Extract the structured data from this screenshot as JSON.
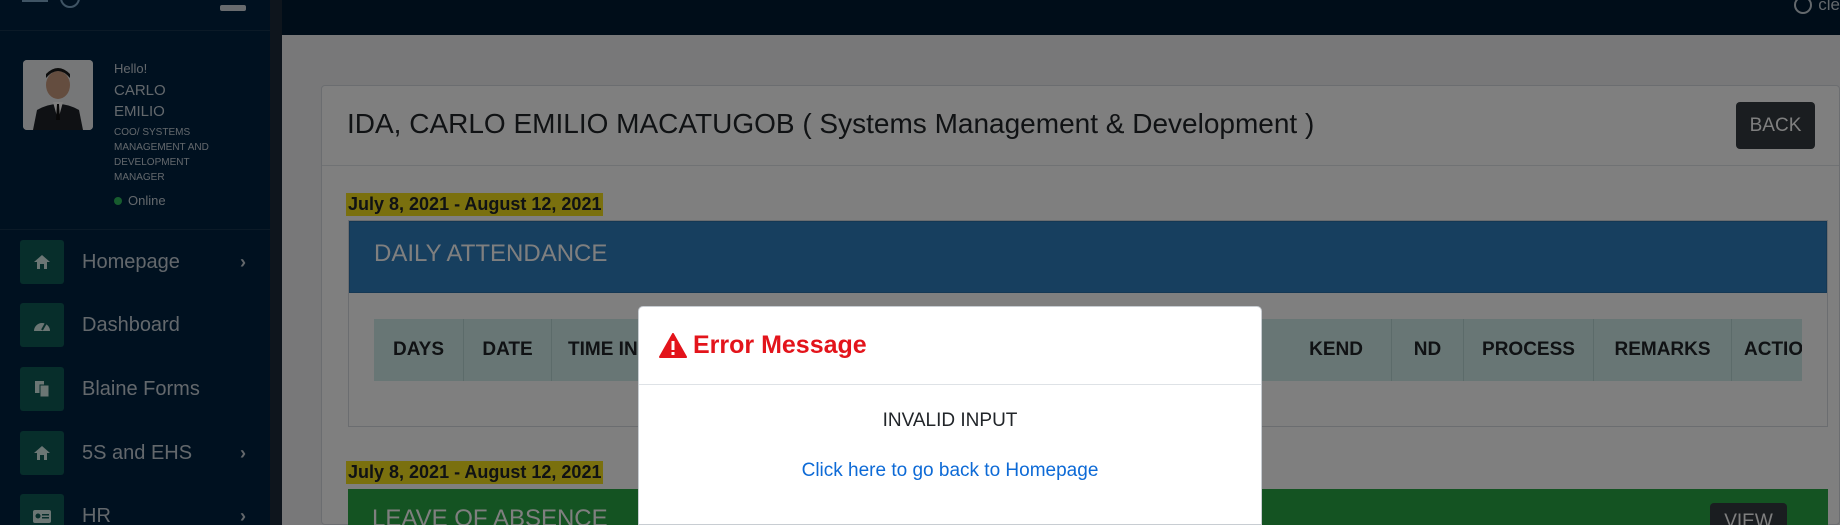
{
  "sidebar": {
    "user": {
      "greeting": "Hello!",
      "name_line1": "CARLO",
      "name_line2": "EMILIO",
      "title": "COO/ SYSTEMS MANAGEMENT AND DEVELOPMENT MANAGER",
      "status": "Online"
    },
    "items": [
      {
        "label": "Homepage",
        "icon": "home-icon",
        "has_submenu": true
      },
      {
        "label": "Dashboard",
        "icon": "dashboard-icon",
        "has_submenu": false
      },
      {
        "label": "Blaine Forms",
        "icon": "forms-icon",
        "has_submenu": false
      },
      {
        "label": "5S and EHS",
        "icon": "home-icon",
        "has_submenu": true
      },
      {
        "label": "HR",
        "icon": "id-card-icon",
        "has_submenu": true
      }
    ],
    "chevron": "›"
  },
  "topbar": {
    "user_label": "cle"
  },
  "card": {
    "employee_title": "IDA, CARLO EMILIO MACATUGOB ( Systems Management & Development )",
    "back_label": "BACK"
  },
  "daily_attendance": {
    "date_range": "July 8, 2021 - August 12, 2021",
    "title": "DAILY ATTENDANCE",
    "columns": [
      "DAYS",
      "DATE",
      "TIME IN",
      "",
      "",
      "",
      "",
      "",
      "",
      "",
      "KEND",
      "ND",
      "PROCESS",
      "REMARKS",
      "ACTION"
    ]
  },
  "leave_of_absence": {
    "date_range": "July 8, 2021 - August 12, 2021",
    "title": "LEAVE OF ABSENCE",
    "view_label": "VIEW"
  },
  "modal": {
    "title": "Error Message",
    "message": "INVALID INPUT",
    "link_text": "Click here to go back to Homepage",
    "title_color": "#e3141b",
    "link_color": "#0d6ad6"
  },
  "colors": {
    "sidebar_bg": "#002240",
    "topbar_bg": "#001a33",
    "attendance_header": "#2f7fbf",
    "loa_header": "#28a745",
    "date_highlight": "#f5e11c"
  }
}
